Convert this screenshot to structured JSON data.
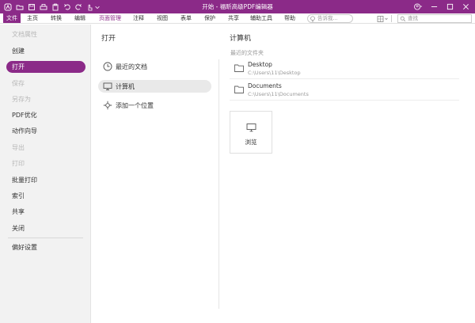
{
  "window": {
    "title": "开始 - 福昕高级PDF编辑器"
  },
  "quick_access": [
    "app-logo-icon",
    "folder-open-icon",
    "save-icon",
    "print-icon",
    "clipboard-icon",
    "undo-icon",
    "redo-icon",
    "hand-cursor-icon",
    "dropdown-icon"
  ],
  "menu": {
    "items": [
      {
        "label": "文件",
        "state": "active"
      },
      {
        "label": "主页",
        "state": "normal"
      },
      {
        "label": "转换",
        "state": "normal"
      },
      {
        "label": "编辑",
        "state": "normal"
      },
      {
        "label": "页面管理",
        "state": "highlight"
      },
      {
        "label": "注释",
        "state": "normal"
      },
      {
        "label": "视图",
        "state": "normal"
      },
      {
        "label": "表单",
        "state": "normal"
      },
      {
        "label": "保护",
        "state": "normal"
      },
      {
        "label": "共享",
        "state": "normal"
      },
      {
        "label": "辅助工具",
        "state": "normal"
      },
      {
        "label": "帮助",
        "state": "normal"
      }
    ],
    "tell_me_placeholder": "告诉我...",
    "search_placeholder": "查找"
  },
  "sidebar": {
    "items": [
      {
        "label": "文档属性",
        "state": "disabled"
      },
      {
        "label": "创建",
        "state": "normal"
      },
      {
        "label": "打开",
        "state": "selected"
      },
      {
        "label": "保存",
        "state": "disabled"
      },
      {
        "label": "另存为",
        "state": "disabled"
      },
      {
        "label": "PDF优化",
        "state": "normal"
      },
      {
        "label": "动作向导",
        "state": "normal"
      },
      {
        "label": "导出",
        "state": "disabled"
      },
      {
        "label": "打印",
        "state": "disabled"
      },
      {
        "label": "批量打印",
        "state": "normal"
      },
      {
        "label": "索引",
        "state": "normal"
      },
      {
        "label": "共享",
        "state": "normal"
      },
      {
        "label": "关闭",
        "state": "normal"
      },
      {
        "label": "偏好设置",
        "state": "normal"
      }
    ]
  },
  "open_panel": {
    "title": "打开",
    "places": [
      {
        "label": "最近的文档",
        "icon": "clock-icon",
        "selected": false
      },
      {
        "label": "计算机",
        "icon": "monitor-icon",
        "selected": true
      },
      {
        "label": "添加一个位置",
        "icon": "add-location-icon",
        "selected": false
      }
    ]
  },
  "computer_panel": {
    "title": "计算机",
    "recent_folders_label": "最近的文件夹",
    "folders": [
      {
        "name": "Desktop",
        "path": "C:\\Users\\11\\Desktop"
      },
      {
        "name": "Documents",
        "path": "C:\\Users\\11\\Documents"
      }
    ],
    "browse_label": "浏览"
  },
  "colors": {
    "accent": "#8b2a88",
    "sidebar_bg": "#f2f2f2",
    "selected_place_bg": "#e9e9e9"
  }
}
